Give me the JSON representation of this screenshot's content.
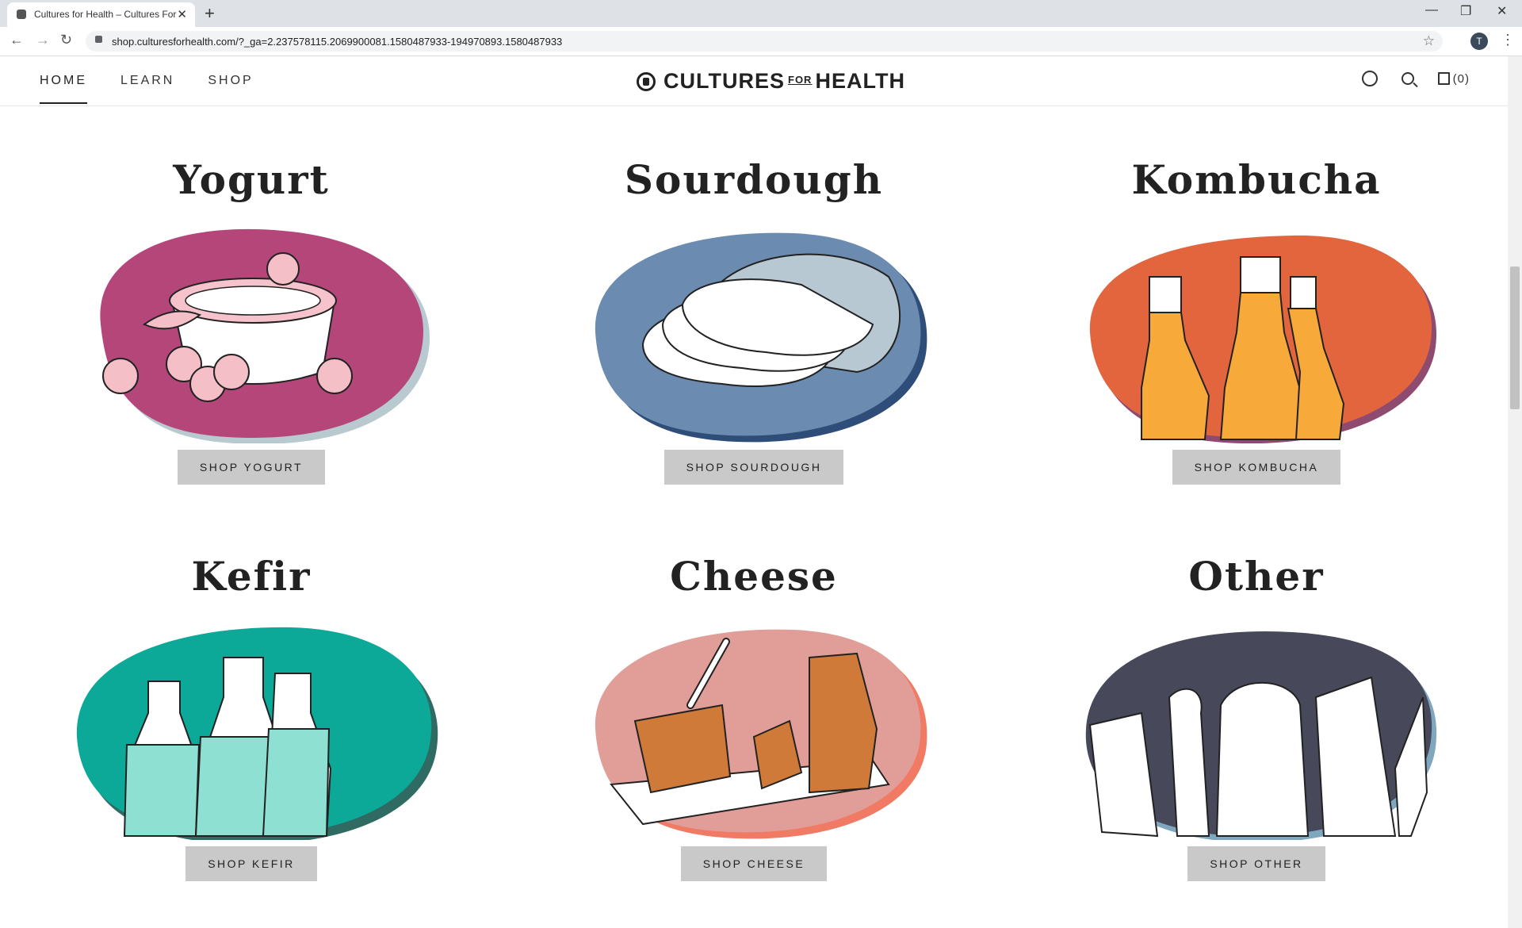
{
  "browser": {
    "tab_title": "Cultures for Health – Cultures For Health",
    "url": "shop.culturesforhealth.com/?_ga=2.237578115.2069900081.1580487933-194970893.1580487933",
    "profile_initial": "T"
  },
  "header": {
    "nav": [
      {
        "label": "HOME",
        "active": true
      },
      {
        "label": "LEARN",
        "active": false
      },
      {
        "label": "SHOP",
        "active": false
      }
    ],
    "logo": {
      "part1": "CULTURES",
      "part2": "FOR",
      "part3": "HEALTH"
    },
    "cart_count": "(0)"
  },
  "categories": [
    {
      "title": "Yogurt",
      "button": "SHOP YOGURT",
      "color": "#b5467a",
      "shadow": "#b8c9d0"
    },
    {
      "title": "Sourdough",
      "button": "SHOP SOURDOUGH",
      "color": "#6b8bb0",
      "shadow": "#2e4e79"
    },
    {
      "title": "Kombucha",
      "button": "SHOP KOMBUCHA",
      "color": "#e2653e",
      "shadow": "#8e4a6f"
    },
    {
      "title": "Kefir",
      "button": "SHOP KEFIR",
      "color": "#0ca898",
      "shadow": "#2f6b63"
    },
    {
      "title": "Cheese",
      "button": "SHOP CHEESE",
      "color": "#e19e99",
      "shadow": "#f07a63"
    },
    {
      "title": "Other",
      "button": "SHOP OTHER",
      "color": "#474859",
      "shadow": "#7fa8bf"
    }
  ]
}
